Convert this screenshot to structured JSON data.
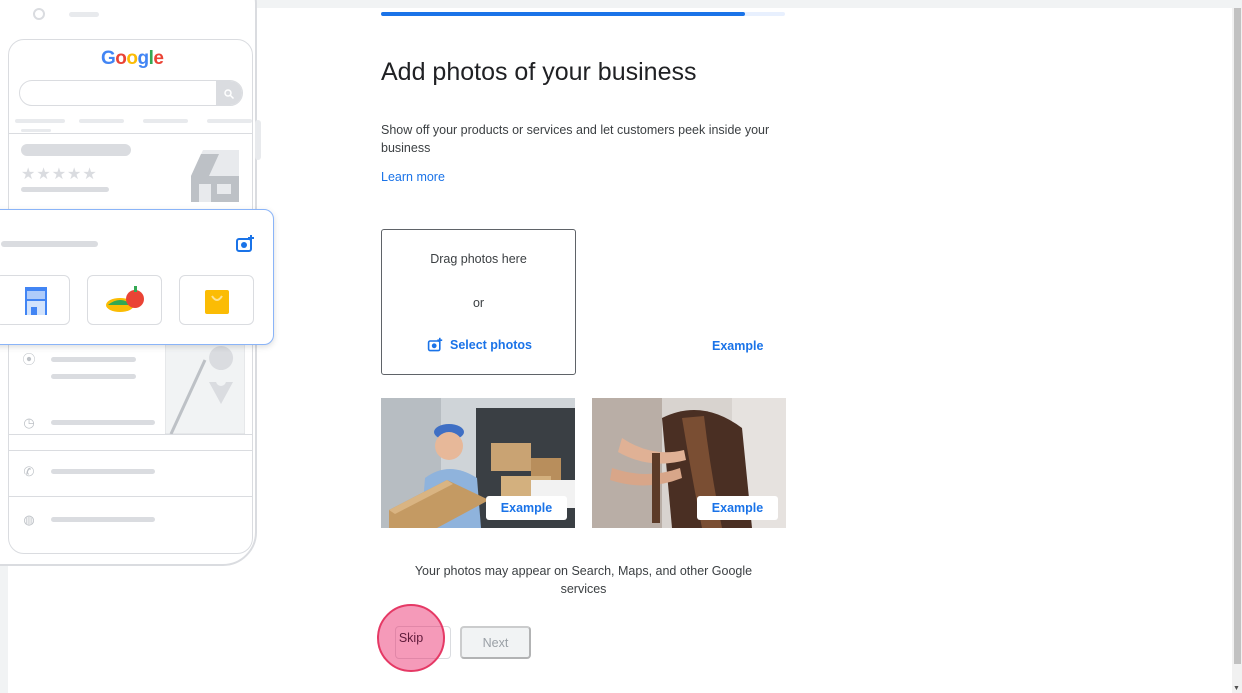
{
  "progress": {
    "fraction": 0.9
  },
  "phone": {
    "logo_letters": [
      "G",
      "o",
      "o",
      "g",
      "l",
      "e"
    ],
    "stars": "★★★★★"
  },
  "main": {
    "title": "Add photos of your business",
    "subtitle": "Show off your products or services and let customers peek inside your business",
    "learn_more": "Learn more",
    "drop_zone": {
      "drag_text": "Drag photos here",
      "or_text": "or",
      "select_label": "Select photos"
    },
    "example_link": "Example",
    "photos": [
      {
        "chip": "Example",
        "subject": "delivery-person"
      },
      {
        "chip": "Example",
        "subject": "hair-stylist"
      }
    ],
    "disclaimer": "Your photos may appear on Search, Maps, and other Google services"
  },
  "footer": {
    "skip_label": "Skip",
    "next_label": "Next"
  },
  "colors": {
    "accent": "#1a73e8",
    "click_highlight": "#e53965"
  }
}
